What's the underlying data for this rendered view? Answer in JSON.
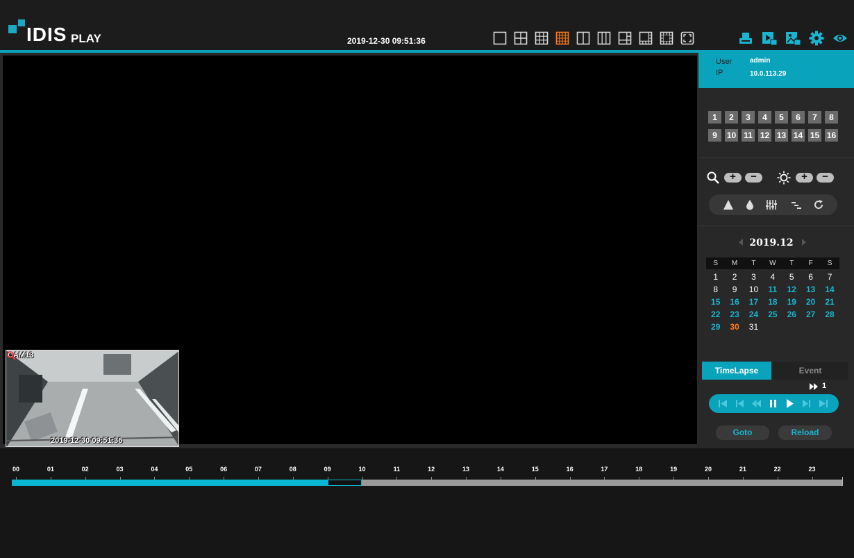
{
  "header": {
    "logo_text": "IDIS",
    "product": "PLAY",
    "datetime": "2019-12-30 09:51:36",
    "layout_options": [
      "layout-1x1",
      "layout-2x2",
      "layout-3x3",
      "layout-4x4",
      "layout-1x2",
      "layout-1x3",
      "layout-1+3",
      "layout-1+5",
      "layout-1+7",
      "fullscreen"
    ],
    "active_layout": "layout-4x4",
    "tool_icons": [
      "export-icon",
      "video-clip-icon",
      "snapshot-icon",
      "settings-icon",
      "view-icon"
    ]
  },
  "user": {
    "user_label": "User",
    "user_value": "admin",
    "ip_label": "IP",
    "ip_value": "10.0.113.29"
  },
  "cameras": {
    "row1": [
      "1",
      "2",
      "3",
      "4",
      "5",
      "6",
      "7",
      "8"
    ],
    "row2": [
      "9",
      "10",
      "11",
      "12",
      "13",
      "14",
      "15",
      "16"
    ]
  },
  "video": {
    "cam_label": "CAM13",
    "cam_timestamp": "2019-12-30 09:51:36"
  },
  "controls": {
    "zoom_plus": "+",
    "zoom_minus": "−",
    "bright_plus": "+",
    "bright_minus": "−"
  },
  "calendar": {
    "title": "2019.12",
    "weekdays": [
      "S",
      "M",
      "T",
      "W",
      "T",
      "F",
      "S"
    ],
    "days": [
      "1",
      "2",
      "3",
      "4",
      "5",
      "6",
      "7",
      "8",
      "9",
      "10",
      "11",
      "12",
      "13",
      "14",
      "15",
      "16",
      "17",
      "18",
      "19",
      "20",
      "21",
      "22",
      "23",
      "24",
      "25",
      "26",
      "27",
      "28",
      "29",
      "30",
      "31"
    ],
    "recorded_from": 11,
    "recorded_to": 29,
    "selected": 30
  },
  "playback": {
    "tab_timelapse": "TimeLapse",
    "tab_event": "Event",
    "speed": "1",
    "goto": "Goto",
    "reload": "Reload"
  },
  "timeline": {
    "hours": [
      "00",
      "01",
      "02",
      "03",
      "04",
      "05",
      "06",
      "07",
      "08",
      "09",
      "10",
      "11",
      "12",
      "13",
      "14",
      "15",
      "16",
      "17",
      "18",
      "19",
      "20",
      "21",
      "22",
      "23"
    ],
    "recorded_until_hour": 9.0,
    "cursor_start_hour": 9.0,
    "cursor_end_hour": 10.0
  },
  "colors": {
    "accent": "#0aa3bc",
    "selected_layout": "#ff7a1a",
    "recorded_day": "#19b4d0",
    "selected_day": "#ff7a1a"
  }
}
